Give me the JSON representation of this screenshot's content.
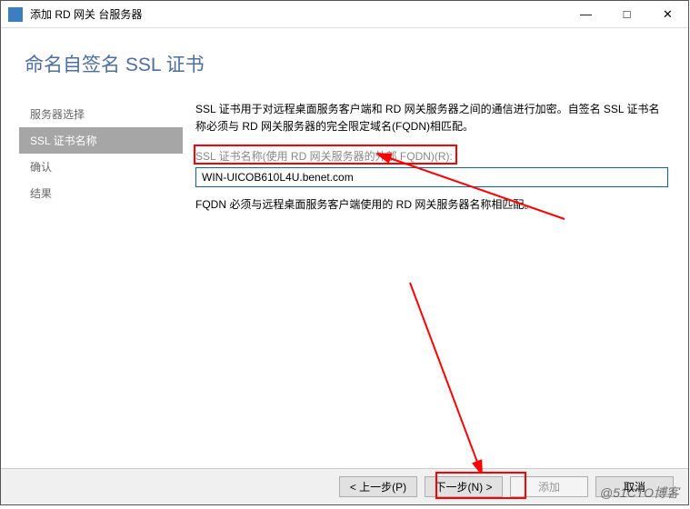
{
  "titlebar": {
    "title": "添加 RD 网关 台服务器"
  },
  "header": {
    "title": "命名自签名 SSL 证书"
  },
  "sidebar": {
    "items": [
      {
        "label": "服务器选择"
      },
      {
        "label": "SSL 证书名称"
      },
      {
        "label": "确认"
      },
      {
        "label": "结果"
      }
    ],
    "active_index": 1
  },
  "main": {
    "description": "SSL 证书用于对远程桌面服务客户端和 RD 网关服务器之间的通信进行加密。自签名 SSL 证书名称必须与 RD 网关服务器的完全限定域名(FQDN)相匹配。",
    "field_label": "SSL 证书名称(使用 RD 网关服务器的外部 FQDN)(R):",
    "field_value": "WIN-UICOB610L4U.benet.com",
    "note": "FQDN 必须与远程桌面服务客户端使用的 RD 网关服务器名称相匹配。"
  },
  "footer": {
    "previous": "< 上一步(P)",
    "next": "下一步(N) >",
    "add": "添加",
    "cancel": "取消"
  },
  "watermark": "@51CTO博客"
}
